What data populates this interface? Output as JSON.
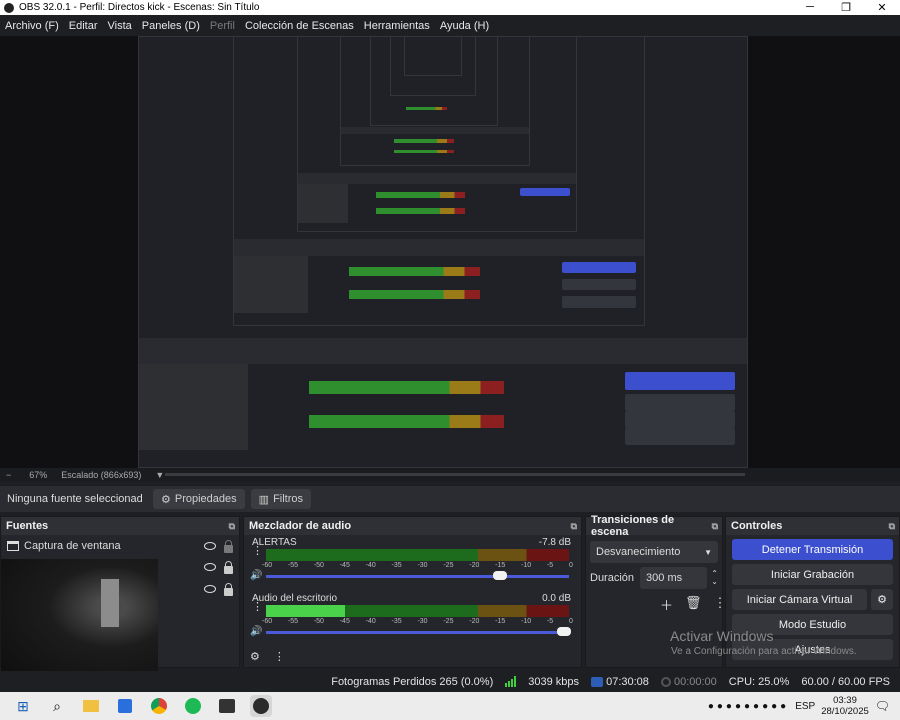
{
  "window": {
    "title": "OBS 32.0.1 - Perfil: Directos kick - Escenas: Sin Título"
  },
  "menu": [
    "Archivo (F)",
    "Editar",
    "Vista",
    "Paneles (D)",
    "Perfil",
    "Colección de Escenas",
    "Herramientas",
    "Ayuda (H)"
  ],
  "preview": {
    "zoom": "67%",
    "scale": "Escalado (866x693)"
  },
  "source_toolbar": {
    "label": "Ninguna fuente seleccionad",
    "properties": "Propiedades",
    "filters": "Filtros"
  },
  "sources": {
    "title": "Fuentes",
    "items": [
      {
        "name": "Captura de ventana"
      }
    ]
  },
  "mixer": {
    "title": "Mezclador de audio",
    "channels": [
      {
        "name": "ALERTAS",
        "db": "-7.8 dB",
        "level": 0.0,
        "volume": 0.78
      },
      {
        "name": "Audio del escritorio",
        "db": "0.0 dB",
        "level": 0.27,
        "volume": 1.0
      }
    ],
    "ticks": [
      "-60",
      "-55",
      "-50",
      "-45",
      "-40",
      "-35",
      "-30",
      "-25",
      "-20",
      "-15",
      "-10",
      "-5",
      "0"
    ]
  },
  "transitions": {
    "title": "Transiciones de escena",
    "selected": "Desvanecimiento",
    "duration_label": "Duración",
    "duration_value": "300 ms"
  },
  "controls": {
    "title": "Controles",
    "buttons": [
      "Detener Transmisión",
      "Iniciar Grabación",
      "Iniciar Cámara Virtual",
      "Modo Estudio",
      "Ajustes"
    ]
  },
  "watermark": {
    "line1": "Activar Windows",
    "line2": "Ve a Configuración para activar Windows."
  },
  "status": {
    "dropped": "Fotogramas Perdidos 265 (0.0%)",
    "bitrate": "3039 kbps",
    "stream_time": "07:30:08",
    "rec_time": "00:00:00",
    "cpu": "CPU: 25.0%",
    "fps": "60.00 / 60.00 FPS"
  },
  "taskbar": {
    "lang": "ESP",
    "time": "03:39",
    "date": "28/10/2025"
  },
  "colors": {
    "accent_blue": "#3b4fcf",
    "meter_green": "#4ad34a"
  }
}
